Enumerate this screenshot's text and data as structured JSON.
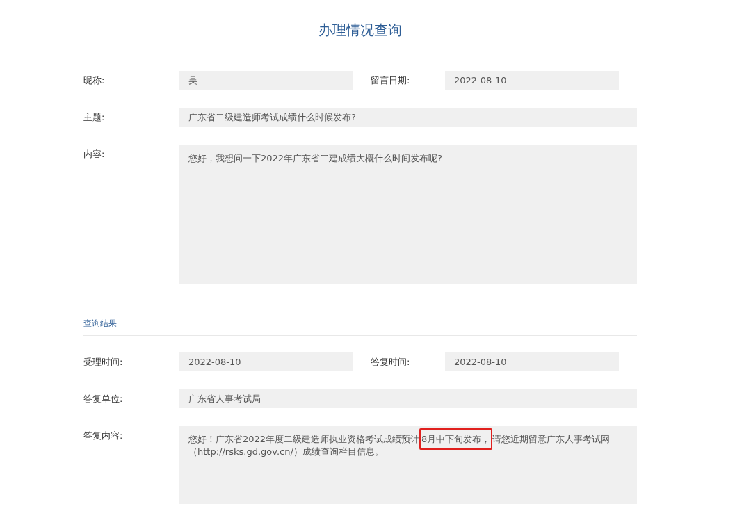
{
  "title": "办理情况查询",
  "message": {
    "rows": [
      {
        "kind": "pair",
        "fields": [
          {
            "label": "昵称:",
            "value": "吴"
          },
          {
            "label": "留言日期:",
            "value": "2022-08-10"
          }
        ]
      },
      {
        "kind": "wide",
        "fields": [
          {
            "label": "主题:",
            "value": "广东省二级建造师考试成绩什么时候发布?"
          }
        ]
      },
      {
        "kind": "area",
        "fields": [
          {
            "label": "内容:",
            "value": "您好，我想问一下2022年广东省二建成绩大概什么时间发布呢?"
          }
        ]
      }
    ]
  },
  "result": {
    "heading": "查询结果",
    "rows": [
      {
        "kind": "pair",
        "fields": [
          {
            "label": "受理时间:",
            "value": "2022-08-10"
          },
          {
            "label": "答复时间:",
            "value": "2022-08-10"
          }
        ]
      },
      {
        "kind": "wide",
        "fields": [
          {
            "label": "答复单位:",
            "value": "广东省人事考试局"
          }
        ]
      },
      {
        "kind": "rich",
        "fields": [
          {
            "label": "答复内容:",
            "parts": [
              {
                "text": "您好！广东省2022年度二级建造师执业资格考试成绩预计",
                "highlighted": false
              },
              {
                "text": "8月中下旬发布，",
                "highlighted": true
              },
              {
                "text": "请您近期留意广东人事考试网（http://rsks.gd.gov.cn/）成绩查询栏目信息。",
                "highlighted": false
              }
            ]
          }
        ]
      }
    ]
  }
}
